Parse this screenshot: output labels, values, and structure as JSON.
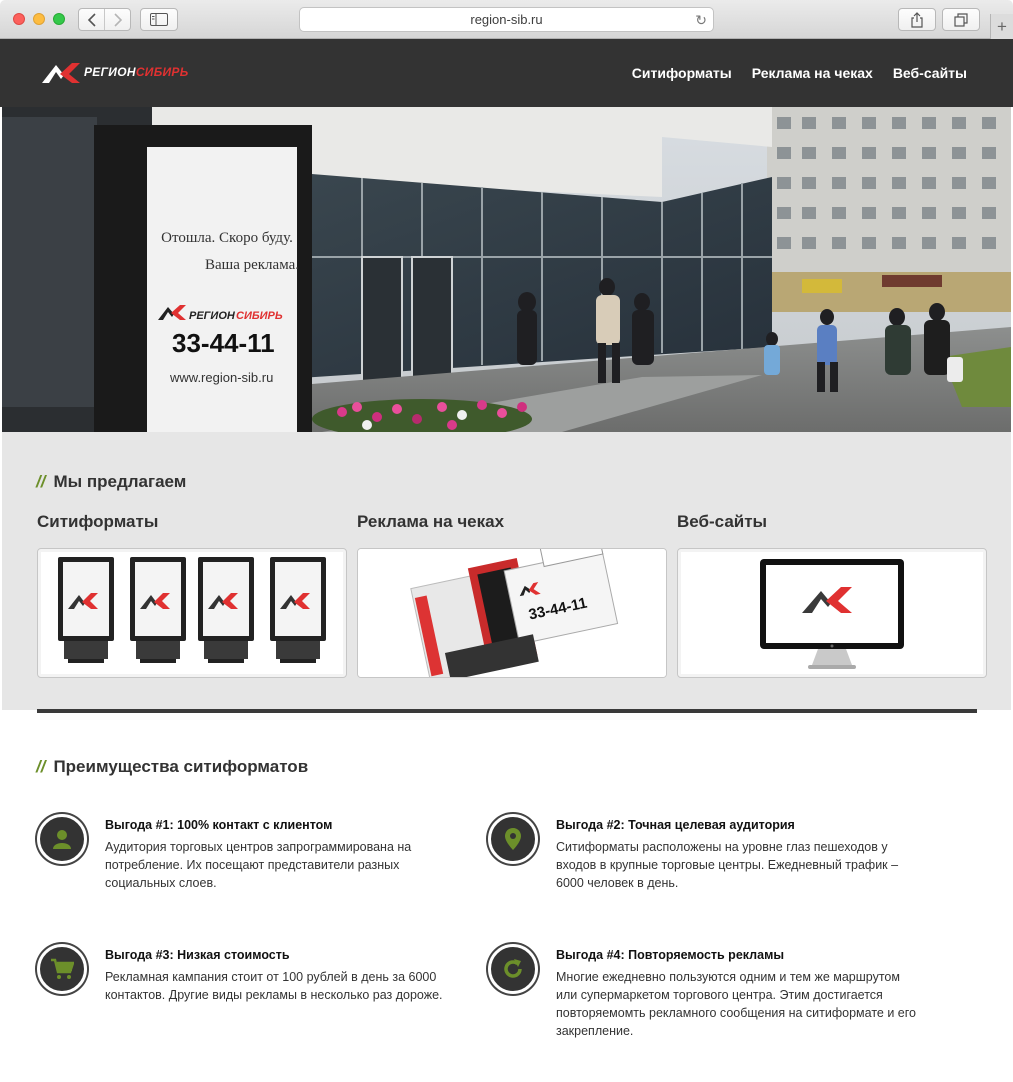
{
  "browser": {
    "url": "region-sib.ru"
  },
  "header": {
    "logo_white": "РЕГИОН",
    "logo_red": "СИБИРЬ",
    "nav": [
      "Ситиформаты",
      "Реклама на чеках",
      "Веб-сайты"
    ]
  },
  "hero": {
    "poster_line1": "Отошла. Скоро буду.",
    "poster_line2": "Ваша реклама.",
    "poster_logo_white": "РЕГИОН",
    "poster_logo_red": "СИБИРЬ",
    "poster_phone": "33-44-11",
    "poster_url": "www.region-sib.ru"
  },
  "offers": {
    "title": "Мы предлагаем",
    "cards": [
      {
        "title": "Ситиформаты"
      },
      {
        "title": "Реклама на чеках"
      },
      {
        "title": "Веб-сайты"
      }
    ],
    "receipt_phone": "33-44-11"
  },
  "benefits": {
    "title": "Преимущества ситиформатов",
    "items": [
      {
        "icon": "user-icon",
        "title": "Выгода #1: 100% контакт с клиентом",
        "text": "Аудитория торговых центров запрограммирована на потребление. Их посещают представители разных социальных слоев."
      },
      {
        "icon": "map-pin-icon",
        "title": "Выгода #2: Точная целевая аудитория",
        "text": "Ситиформаты расположены на уровне глаз пешеходов у входов в крупные торговые центры. Ежедневный трафик – 6000 человек в день."
      },
      {
        "icon": "cart-icon",
        "title": "Выгода #3: Низкая стоимость",
        "text": "Рекламная кампания стоит от 100 рублей в день за 6000 контактов. Другие виды рекламы в несколько раз дороже."
      },
      {
        "icon": "refresh-icon",
        "title": "Выгода #4: Повторяемость рекламы",
        "text": "Многие ежедневно пользуются одним и тем же маршрутом или супермаркетом торгового центра. Этим достигается повторяемомть рекламного сообщения на ситиформате и его закрепление."
      }
    ]
  },
  "colors": {
    "header_bg": "#333333",
    "accent_red": "#e03131",
    "accent_green": "#6c8f2a",
    "section_bg": "#e6e6e6"
  }
}
